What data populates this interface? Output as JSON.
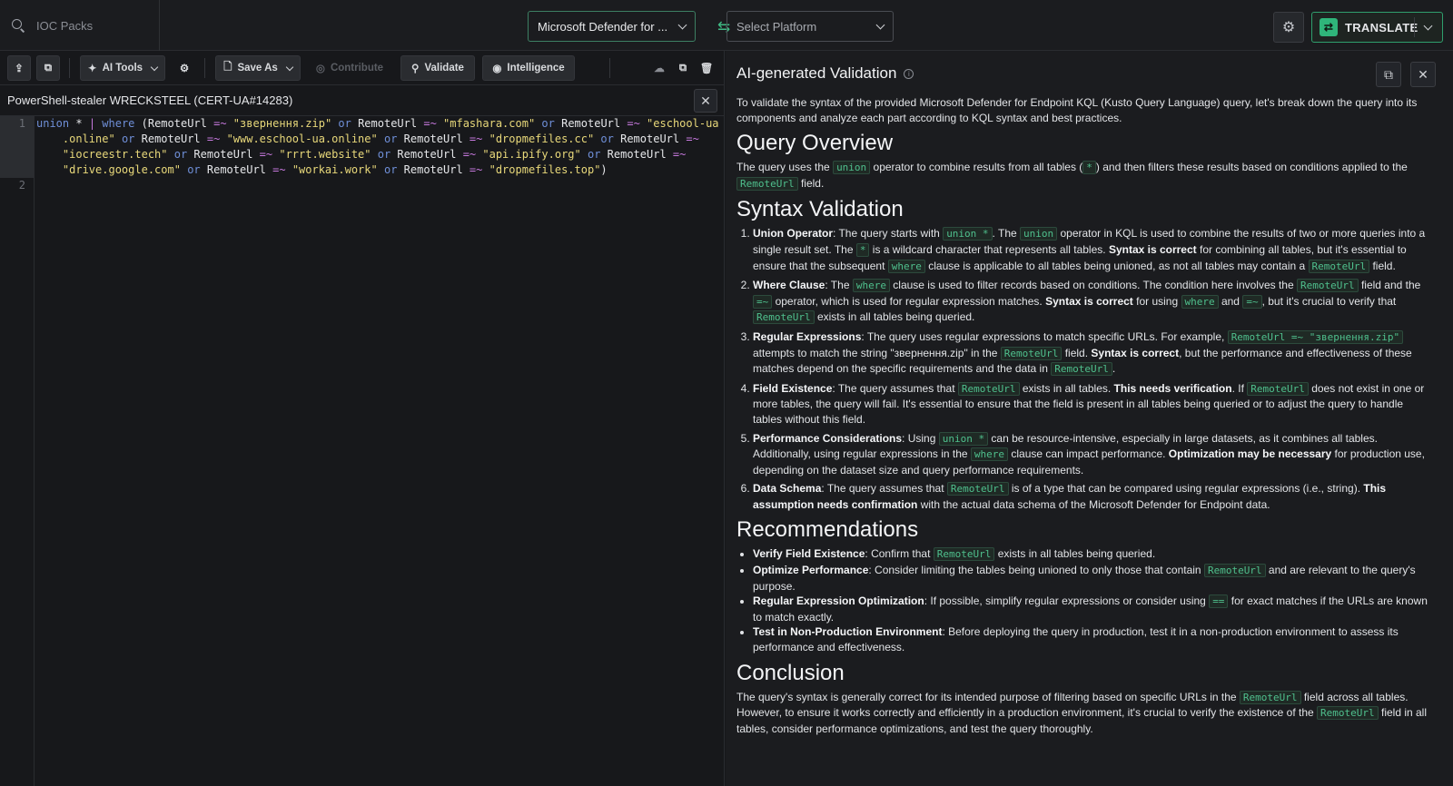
{
  "header": {
    "search_placeholder": "IOC Packs",
    "source_platform": "Microsoft Defender for ...",
    "target_platform_placeholder": "Select Platform",
    "translate_label": "TRANSLATE"
  },
  "toolbar": {
    "ai_tools": "AI Tools",
    "save_as": "Save As",
    "contribute": "Contribute",
    "validate": "Validate",
    "intelligence": "Intelligence"
  },
  "editor": {
    "tab_title": "PowerShell-stealer WRECKSTEEL (CERT-UA#14283)",
    "line_numbers": [
      "1",
      "2"
    ]
  },
  "panel": {
    "title": "AI-generated Validation",
    "intro": "To validate the syntax of the provided Microsoft Defender for Endpoint KQL (Kusto Query Language) query, let's break down the query into its components and analyze each part according to KQL syntax and best practices.",
    "h_overview": "Query Overview",
    "h_syntax": "Syntax Validation",
    "h_recommendations": "Recommendations",
    "h_conclusion": "Conclusion"
  },
  "colors": {
    "accent": "#2fb57a",
    "background": "#16171a",
    "code_highlight": "#4fc08d"
  }
}
